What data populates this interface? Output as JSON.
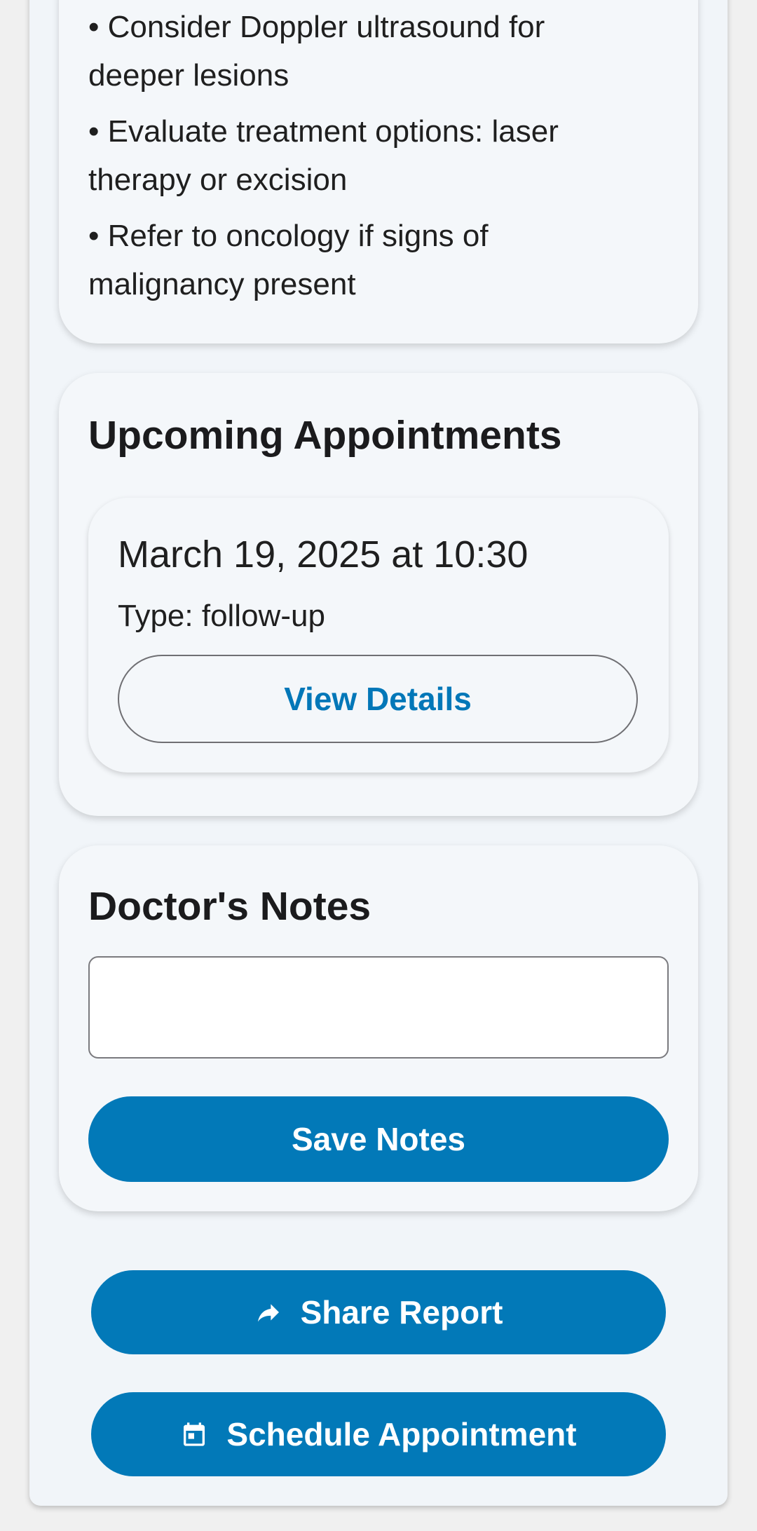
{
  "recommendations": {
    "items": [
      {
        "line1": "• Consider Doppler ultrasound for",
        "line2": "deeper lesions"
      },
      {
        "line1": "• Evaluate treatment options: laser",
        "line2": "therapy or excision"
      },
      {
        "line1": "• Refer to oncology if signs of",
        "line2": "malignancy present"
      }
    ]
  },
  "appointments": {
    "title": "Upcoming Appointments",
    "items": [
      {
        "date": "March 19, 2025 at 10:30",
        "type": "Type: follow-up",
        "details_label": "View Details"
      }
    ]
  },
  "notes": {
    "title": "Doctor's Notes",
    "value": "",
    "save_label": "Save Notes"
  },
  "actions": {
    "share_label": "Share Report",
    "share_icon": "share-arrow-icon",
    "schedule_label": "Schedule Appointment",
    "schedule_icon": "calendar-icon"
  },
  "colors": {
    "primary": "#0279b8",
    "card_bg": "#f4f7fa",
    "page_bg": "#f0f0f0"
  }
}
